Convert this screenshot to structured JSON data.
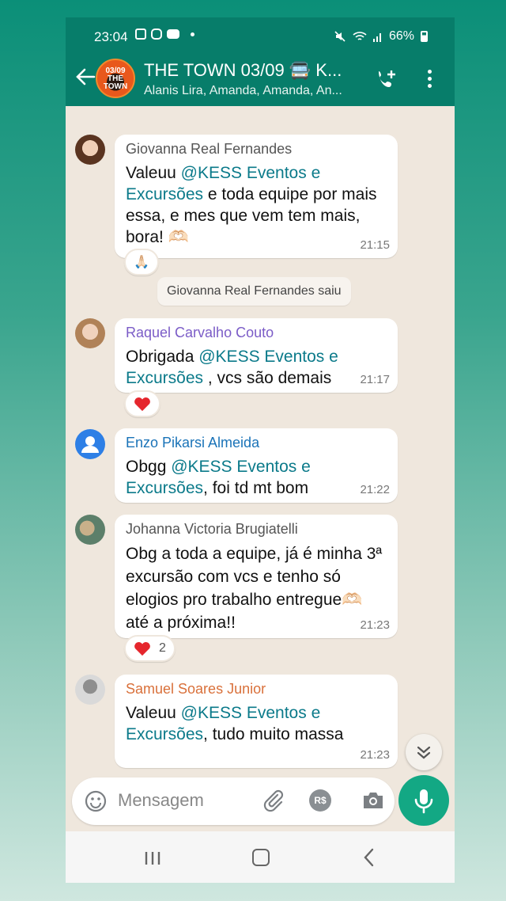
{
  "status_bar": {
    "time": "23:04",
    "battery": "66%"
  },
  "header": {
    "group_title": "THE TOWN 03/09 🚍 K...",
    "group_subtitle": "Alanis Lira, Amanda, Amanda, An...",
    "avatar_text": "03/09 THE TOWN",
    "accent": "#077d6a"
  },
  "messages": [
    {
      "sender": "Giovanna Real Fernandes",
      "sender_color": "#555555",
      "text_before": "Valeuu ",
      "mention": "@KESS Eventos e Excursões",
      "text_after": " e toda equipe por mais essa, e mes que vem tem mais, bora! 🫶🏻",
      "time": "21:15",
      "reaction": "🙏🏻",
      "reaction_count": ""
    },
    {
      "sender": "Raquel Carvalho Couto",
      "sender_color": "#7b5cc7",
      "text_before": "Obrigada ",
      "mention": "@KESS Eventos e Excursões",
      "text_after": " , vcs são demais",
      "time": "21:17",
      "reaction": "heart",
      "reaction_count": ""
    },
    {
      "sender": "Enzo Pikarsi Almeida",
      "sender_color": "#1a73b8",
      "text_before": "Obgg ",
      "mention": "@KESS Eventos e Excursões",
      "text_after": ", foi td mt bom",
      "time": "21:22"
    },
    {
      "sender": "Johanna Victoria Brugiatelli",
      "sender_color": "#555555",
      "text": "Obg a toda a equipe, já é minha 3ª excursão com vcs e tenho só elogios pro trabalho entregue🫶🏻 até a próxima!!",
      "time": "21:23",
      "reaction": "heart",
      "reaction_count": "2"
    },
    {
      "sender": "Samuel Soares Junior",
      "sender_color": "#d9703a",
      "text_before": "Valeuu ",
      "mention": "@KESS Eventos e Excursões",
      "text_after": ", tudo muito massa",
      "time": "21:23"
    }
  ],
  "system_message": "Giovanna Real Fernandes saiu",
  "composer": {
    "placeholder": "Mensagem",
    "pay_label": "R$"
  },
  "icons": {
    "back": "arrow-left-icon",
    "call": "add-call-icon",
    "menu": "more-vert-icon",
    "emoji": "emoji-icon",
    "attach": "paperclip-icon",
    "camera": "camera-icon",
    "mic": "mic-icon",
    "scroll": "chevron-double-down-icon"
  }
}
